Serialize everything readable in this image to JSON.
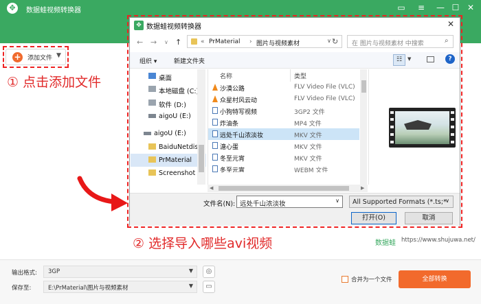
{
  "app": {
    "title": "数据蛙视频转换器",
    "logo_glyph": "✥",
    "controls": [
      "▭",
      "≡",
      "—",
      "☐",
      "✕"
    ],
    "add_file_label": "添加文件",
    "accent_color": "#3aa961",
    "orange_color": "#f26a2c"
  },
  "annotations": {
    "step1": "① 点击添加文件",
    "step2": "② 选择导入哪些avi视频",
    "annotation_color": "#e12a2a"
  },
  "watermark": {
    "brand": "数据蛙",
    "url": "https://www.shujuwa.net/"
  },
  "bottom_bar": {
    "output_format_label": "输出格式:",
    "output_format_value": "3GP",
    "save_to_label": "保存至:",
    "save_to_value": "E:\\PrMaterial\\图片与视频素材",
    "merge_label": "合并为一个文件",
    "convert_all_label": "全部转换"
  },
  "dialog": {
    "title": "数据蛙视频转换器",
    "breadcrumb": [
      "«",
      "PrMaterial",
      "›",
      "图片与视频素材"
    ],
    "search_placeholder": "在 图片与视频素材 中搜索",
    "toolbar": {
      "organize": "组织 ▾",
      "new_folder": "新建文件夹"
    },
    "tree": [
      {
        "label": "桌面",
        "icon": "desktop-icon"
      },
      {
        "label": "本地磁盘 (C:)",
        "icon": "drive-icon"
      },
      {
        "label": "软件 (D:)",
        "icon": "drive-icon"
      },
      {
        "label": "aigoU (E:)",
        "icon": "drive-icon"
      },
      {
        "label": "aigoU (E:)",
        "icon": "usb-drive-icon"
      },
      {
        "label": "BaiduNetdisk",
        "icon": "folder-icon"
      },
      {
        "label": "PrMaterial",
        "icon": "folder-icon",
        "selected": true
      },
      {
        "label": "Screenshot",
        "icon": "folder-icon"
      }
    ],
    "columns": {
      "name": "名称",
      "type": "类型"
    },
    "files": [
      {
        "name": "沙漠公路",
        "type": "FLV Video File (VLC)",
        "icon": "vlc-icon"
      },
      {
        "name": "众星村风云动",
        "type": "FLV Video File (VLC)",
        "icon": "vlc-icon"
      },
      {
        "name": "小狗特写视频",
        "type": "3GP2 文件",
        "icon": "video-file-icon"
      },
      {
        "name": "炸油条",
        "type": "MP4 文件",
        "icon": "video-file-icon"
      },
      {
        "name": "远处千山浓淡妆",
        "type": "MKV 文件",
        "icon": "video-file-icon",
        "selected": true
      },
      {
        "name": "溏心蛋",
        "type": "MKV 文件",
        "icon": "video-file-icon"
      },
      {
        "name": "冬至元宵",
        "type": "MKV 文件",
        "icon": "video-file-icon"
      },
      {
        "name": "冬至元宵",
        "type": "WEBM 文件",
        "icon": "video-file-icon"
      }
    ],
    "filename_label": "文件名(N):",
    "filename_value": "远处千山浓淡妆",
    "format_value": "All Supported Formats (*.ts;*",
    "open_label": "打开(O)",
    "cancel_label": "取消"
  }
}
